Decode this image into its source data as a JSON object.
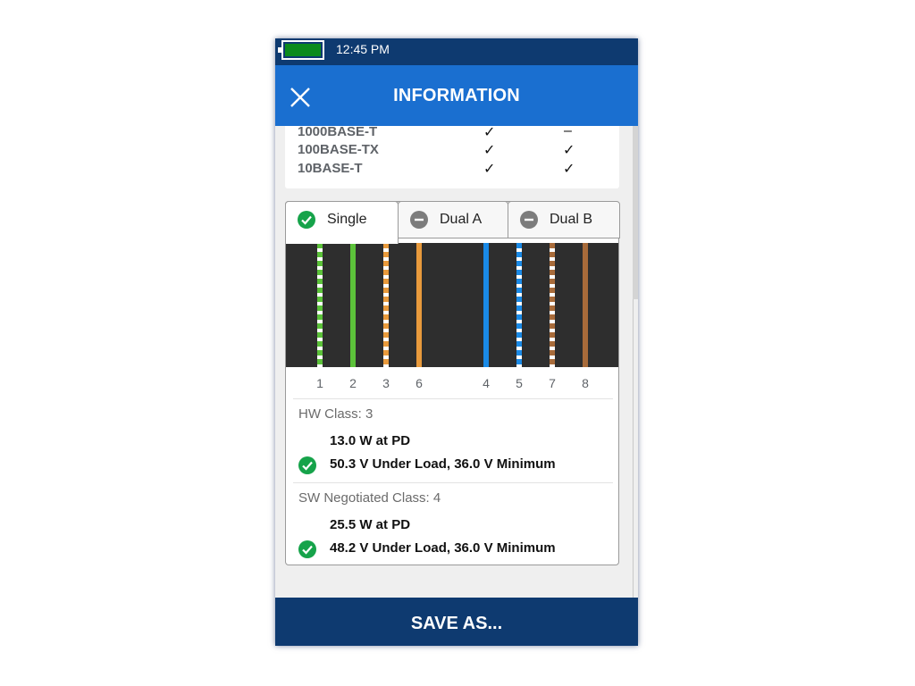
{
  "status_bar": {
    "time": "12:45 PM",
    "battery_level": 1.0,
    "battery_color": "#0b8a1c"
  },
  "header": {
    "title": "INFORMATION",
    "close_icon": "close-icon"
  },
  "speeds": [
    {
      "label": "1000BASE-T",
      "col1": "✓",
      "col2": "–"
    },
    {
      "label": "100BASE-TX",
      "col1": "✓",
      "col2": "✓"
    },
    {
      "label": "10BASE-T",
      "col1": "✓",
      "col2": "✓"
    }
  ],
  "tabs": [
    {
      "label": "Single",
      "state": "ok",
      "active": true
    },
    {
      "label": "Dual A",
      "state": "minus",
      "active": false
    },
    {
      "label": "Dual B",
      "state": "minus",
      "active": false
    }
  ],
  "wires": [
    {
      "pin": "1",
      "color": "#5cc23a",
      "striped": true
    },
    {
      "pin": "2",
      "color": "#5cc23a",
      "striped": false
    },
    {
      "pin": "3",
      "color": "#e89a3c",
      "striped": true
    },
    {
      "pin": "6",
      "color": "#e89a3c",
      "striped": false
    },
    {
      "pin": "4",
      "color": "#1a8ae6",
      "striped": false
    },
    {
      "pin": "5",
      "color": "#1a8ae6",
      "striped": true
    },
    {
      "pin": "7",
      "color": "#a86b3a",
      "striped": true
    },
    {
      "pin": "8",
      "color": "#a86b3a",
      "striped": false
    }
  ],
  "hw": {
    "class_label": "HW Class: 3",
    "power": "13.0 W at PD",
    "voltage": "50.3 V Under Load, 36.0 V Minimum"
  },
  "sw": {
    "class_label": "SW Negotiated Class: 4",
    "power": "25.5 W at PD",
    "voltage": "48.2 V Under Load, 36.0 V Minimum"
  },
  "footer": {
    "save_label": "SAVE AS..."
  },
  "colors": {
    "header_blue": "#1a6fd0",
    "navy": "#0e3a70",
    "ok_green": "#16a34a",
    "minus_gray": "#7c7c7c"
  }
}
